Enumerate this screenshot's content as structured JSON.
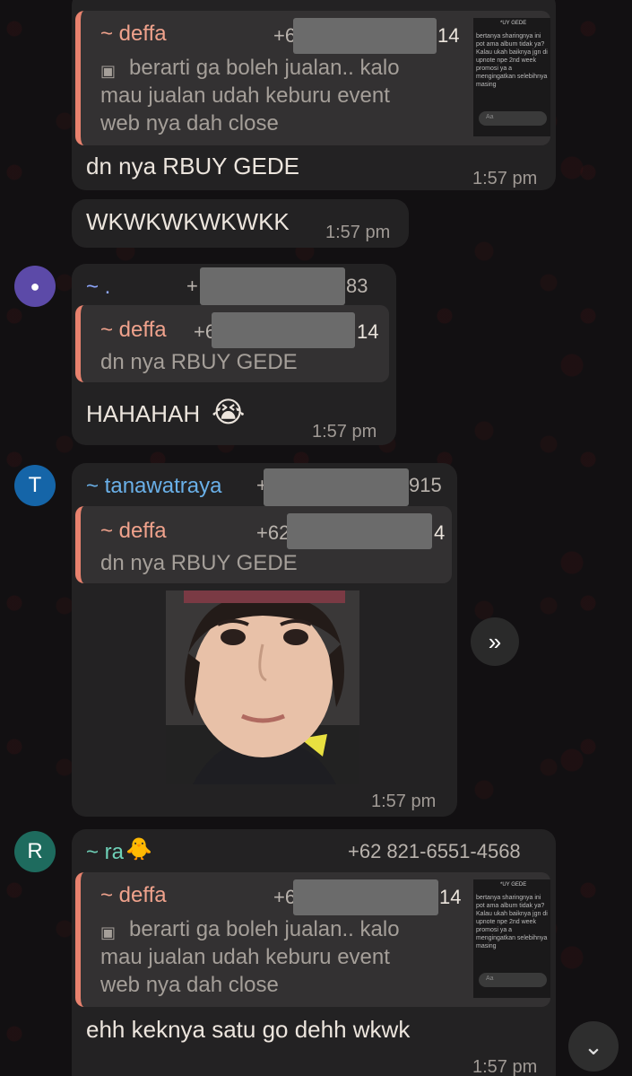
{
  "messages": [
    {
      "id": "m1",
      "quote": {
        "name": "~ deffa",
        "phone_start": "+6",
        "phone_end": "14",
        "text_line1": "berarti ga boleh jualan.. kalo",
        "text_line2": "mau jualan udah keburu event",
        "text_line3": "web nya dah close",
        "thumb_text": "bertanya sharingnya ini pot ama album tidak ya? Kalau ukah baiknya jgn di upnote npe 2nd week promosi ya a mengingatkan selebihnya masing",
        "thumb_header": "*UY GEDE",
        "thumb_input_hint": "Aa"
      },
      "text": "dn nya RBUY GEDE",
      "time": "1:57 pm"
    },
    {
      "id": "m2",
      "text": "WKWKWKWKWKK",
      "time": "1:57 pm"
    },
    {
      "id": "m3",
      "sender": {
        "name": "~ .",
        "phone_start": "+",
        "phone_end": "83",
        "avatar_color": "#5c4aa8"
      },
      "quote": {
        "name": "~ deffa",
        "phone_start": "+6",
        "phone_end": "14",
        "text": "dn nya RBUY GEDE"
      },
      "text": "HAHAHAH",
      "emoji": "😭",
      "time": "1:57 pm"
    },
    {
      "id": "m4",
      "sender": {
        "name": "~ tanawatraya",
        "phone_start": "+",
        "phone_end": "915",
        "avatar_letter": "T",
        "avatar_color": "#1565a8"
      },
      "quote": {
        "name": "~ deffa",
        "phone_start": "+62",
        "phone_end": "4",
        "text": "dn nya RBUY GEDE"
      },
      "time": "1:57 pm"
    },
    {
      "id": "m5",
      "sender": {
        "name": "~ ra",
        "emoji": "🐥",
        "phone": "+62 821-6551-4568",
        "avatar_letter": "R",
        "avatar_color": "#1e6b5e"
      },
      "quote": {
        "name": "~ deffa",
        "phone_start": "+6",
        "phone_end": "14",
        "text_line1": "berarti ga boleh jualan.. kalo",
        "text_line2": "mau jualan udah keburu event",
        "text_line3": "web nya dah close",
        "thumb_text": "bertanya sharingnya ini pot ama album tidak ya? Kalau ukah baiknya jgn di upnote npe 2nd week promosi ya a mengingatkan selebihnya masing",
        "thumb_header": "*UY GEDE",
        "thumb_input_hint": "Aa"
      },
      "text": "ehh keknya satu go dehh wkwk",
      "time": "1:57 pm"
    }
  ],
  "icons": {
    "image_icon": "🖼",
    "person_icon": "👤",
    "forward_icon": "»",
    "scroll_down_icon": "⌄"
  },
  "colors": {
    "quote_accent": "#e8826e",
    "quote_name": "#f0a28c",
    "tanawatraya_name": "#6ab0e8",
    "ra_name": "#6fd1b8",
    "dot_name": "#8fa8ff"
  }
}
